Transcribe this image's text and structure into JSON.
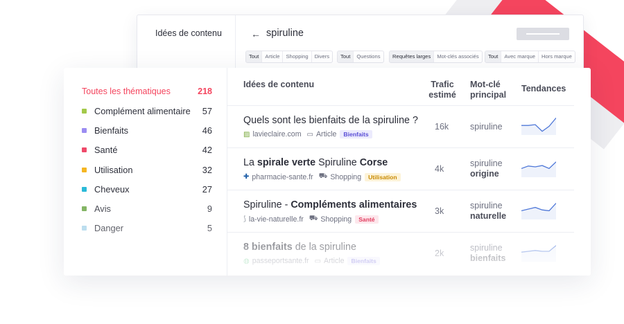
{
  "back": {
    "left_title": "Idées de contenu",
    "search": "spiruline",
    "filters": [
      {
        "items": [
          "Tout",
          "Article",
          "Shopping",
          "Divers"
        ],
        "active": 0
      },
      {
        "items": [
          "Tout",
          "Questions"
        ],
        "active": 0
      },
      {
        "items": [
          "Requêtes larges",
          "Mot-clés associés"
        ],
        "active": 0
      },
      {
        "items": [
          "Tout",
          "Avec marque",
          "Hors marque"
        ],
        "active": 0
      }
    ]
  },
  "sidebar": {
    "all_label": "Toutes les thématiques",
    "all_count": "218",
    "items": [
      {
        "label": "Complément alimentaire",
        "count": "57",
        "color": "#a3c94a"
      },
      {
        "label": "Bienfaits",
        "count": "46",
        "color": "#9b8df2"
      },
      {
        "label": "Santé",
        "count": "42",
        "color": "#ef4a6a"
      },
      {
        "label": "Utilisation",
        "count": "32",
        "color": "#f5b623"
      },
      {
        "label": "Cheveux",
        "count": "27",
        "color": "#2bbad8"
      },
      {
        "label": "Avis",
        "count": "9",
        "color": "#6fa84a"
      },
      {
        "label": "Danger",
        "count": "5",
        "color": "#a8d4ea"
      }
    ]
  },
  "table": {
    "col_ideas": "Idées de contenu",
    "col_traffic_1": "Trafic",
    "col_traffic_2": "estimé",
    "col_kw_1": "Mot-clé",
    "col_kw_2": "principal",
    "col_trends": "Tendances",
    "rows": [
      {
        "title_parts": [
          {
            "t": "Quels sont les bienfaits de la spiruline ?",
            "b": false
          }
        ],
        "site": "lavieclaire.com",
        "site_icon": "leaf-favicon-icon",
        "type": "Article",
        "type_icon": "monitor-icon",
        "badge": "Bienfaits",
        "badge_color": "#5b4fd6",
        "badge_bg": "#ecebfd",
        "traffic": "16k",
        "kw_1": "spiruline",
        "kw_2": "",
        "trend": [
          0.55,
          0.55,
          0.5,
          0.9,
          0.6,
          0.1
        ]
      },
      {
        "title_parts": [
          {
            "t": "La ",
            "b": false
          },
          {
            "t": "spirale verte",
            "b": true
          },
          {
            "t": " Spiruline ",
            "b": false
          },
          {
            "t": "Corse",
            "b": true
          }
        ],
        "site": "pharmacie-sante.fr",
        "site_icon": "shield-cross-favicon-icon",
        "type": "Shopping",
        "type_icon": "cart-icon",
        "badge": "Utilisation",
        "badge_color": "#c98a00",
        "badge_bg": "#fdf3d8",
        "traffic": "4k",
        "kw_1": "spiruline",
        "kw_2": "origine",
        "trend": [
          0.6,
          0.45,
          0.5,
          0.42,
          0.6,
          0.2
        ]
      },
      {
        "title_parts": [
          {
            "t": "Spiruline - ",
            "b": false
          },
          {
            "t": "Compléments alimentaires",
            "b": true
          }
        ],
        "site": "la-vie-naturelle.fr",
        "site_icon": "leaf-stroke-favicon-icon",
        "type": "Shopping",
        "type_icon": "cart-icon",
        "badge": "Santé",
        "badge_color": "#e23d5f",
        "badge_bg": "#fde7ec",
        "traffic": "3k",
        "kw_1": "spiruline",
        "kw_2": "naturelle",
        "trend": [
          0.6,
          0.5,
          0.4,
          0.55,
          0.6,
          0.15
        ]
      },
      {
        "title_parts": [
          {
            "t": "8 bienfaits",
            "b": true
          },
          {
            "t": " de la spiruline",
            "b": false
          }
        ],
        "site": "passeportsante.fr",
        "site_icon": "globe-favicon-icon",
        "type": "Article",
        "type_icon": "monitor-icon",
        "badge": "Bienfaits",
        "badge_color": "#5b4fd6",
        "badge_bg": "#ecebfd",
        "traffic": "2k",
        "kw_1": "spiruline",
        "kw_2": "bienfaits",
        "trend": [
          0.55,
          0.5,
          0.45,
          0.5,
          0.5,
          0.15
        ]
      }
    ]
  }
}
